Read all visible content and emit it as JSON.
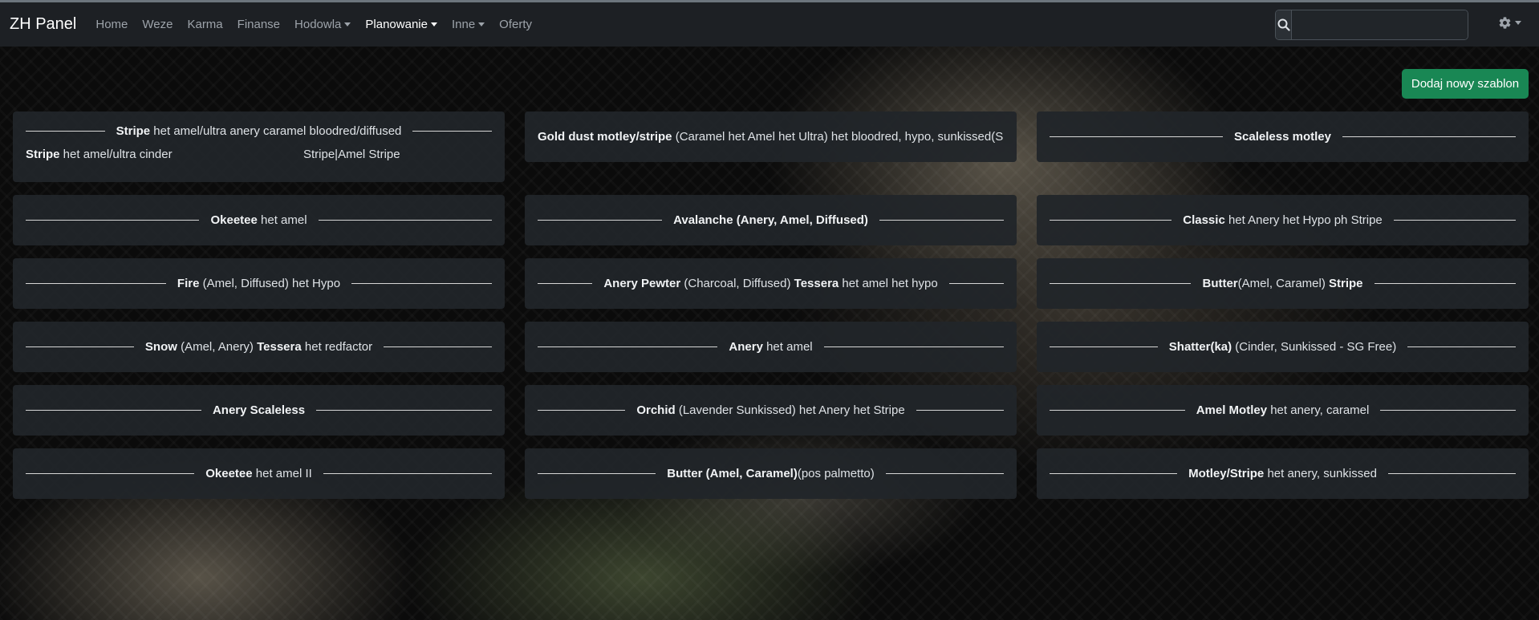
{
  "navbar": {
    "brand": "ZH Panel",
    "items": [
      {
        "label": "Home",
        "dropdown": false,
        "active": false
      },
      {
        "label": "Weze",
        "dropdown": false,
        "active": false
      },
      {
        "label": "Karma",
        "dropdown": false,
        "active": false
      },
      {
        "label": "Finanse",
        "dropdown": false,
        "active": false
      },
      {
        "label": "Hodowla",
        "dropdown": true,
        "active": false
      },
      {
        "label": "Planowanie",
        "dropdown": true,
        "active": true
      },
      {
        "label": "Inne",
        "dropdown": true,
        "active": false
      },
      {
        "label": "Oferty",
        "dropdown": false,
        "active": false
      }
    ],
    "search": {
      "value": "",
      "placeholder": "",
      "icon": "search-icon"
    },
    "settings": {
      "icon": "gear-icon",
      "dropdown": true
    }
  },
  "actions": {
    "add_template_label": "Dodaj nowy szablon",
    "add_template_color": "#198754"
  },
  "cards": [
    {
      "parts": [
        {
          "text": "Stripe",
          "bold": true
        },
        {
          "text": " het amel/ultra anery caramel bloodred/diffused",
          "bold": false
        }
      ],
      "subrow": {
        "left": [
          {
            "text": "Stripe",
            "bold": true
          },
          {
            "text": " het amel/ultra cinder",
            "bold": false
          }
        ],
        "right": "Stripe|Amel Stripe"
      }
    },
    {
      "align": "left",
      "parts": [
        {
          "text": "Gold dust motley/stripe",
          "bold": true
        },
        {
          "text": " (Caramel het Amel het Ultra) het bloodred, hypo, sunkissed(SG fre",
          "bold": false
        }
      ]
    },
    {
      "parts": [
        {
          "text": "Scaleless motley",
          "bold": true
        }
      ]
    },
    {
      "parts": [
        {
          "text": "Okeetee",
          "bold": true
        },
        {
          "text": " het amel",
          "bold": false
        }
      ]
    },
    {
      "parts": [
        {
          "text": "Avalanche (Anery, Amel, Diffused)",
          "bold": true
        }
      ]
    },
    {
      "parts": [
        {
          "text": "Classic",
          "bold": true
        },
        {
          "text": " het Anery het Hypo ph Stripe",
          "bold": false
        }
      ]
    },
    {
      "parts": [
        {
          "text": "Fire",
          "bold": true
        },
        {
          "text": " (Amel, Diffused) het Hypo",
          "bold": false
        }
      ]
    },
    {
      "parts": [
        {
          "text": "Anery Pewter",
          "bold": true
        },
        {
          "text": " (Charcoal, Diffused) ",
          "bold": false
        },
        {
          "text": "Tessera",
          "bold": true
        },
        {
          "text": " het amel het hypo",
          "bold": false
        }
      ]
    },
    {
      "parts": [
        {
          "text": "Butter",
          "bold": true
        },
        {
          "text": "(Amel, Caramel) ",
          "bold": false
        },
        {
          "text": "Stripe",
          "bold": true
        }
      ]
    },
    {
      "parts": [
        {
          "text": "Snow",
          "bold": true
        },
        {
          "text": " (Amel, Anery) ",
          "bold": false
        },
        {
          "text": "Tessera",
          "bold": true
        },
        {
          "text": " het redfactor",
          "bold": false
        }
      ]
    },
    {
      "parts": [
        {
          "text": "Anery",
          "bold": true
        },
        {
          "text": " het amel",
          "bold": false
        }
      ]
    },
    {
      "parts": [
        {
          "text": "Shatter(ka)",
          "bold": true
        },
        {
          "text": " (Cinder, Sunkissed - SG Free)",
          "bold": false
        }
      ]
    },
    {
      "parts": [
        {
          "text": "Anery Scaleless",
          "bold": true
        }
      ]
    },
    {
      "parts": [
        {
          "text": "Orchid",
          "bold": true
        },
        {
          "text": " (Lavender Sunkissed) het Anery het Stripe",
          "bold": false
        }
      ]
    },
    {
      "parts": [
        {
          "text": "Amel Motley",
          "bold": true
        },
        {
          "text": " het anery, caramel",
          "bold": false
        }
      ]
    },
    {
      "parts": [
        {
          "text": "Okeetee",
          "bold": true
        },
        {
          "text": " het amel II",
          "bold": false
        }
      ]
    },
    {
      "parts": [
        {
          "text": "Butter (Amel, Caramel)",
          "bold": true
        },
        {
          "text": "(pos palmetto)",
          "bold": false
        }
      ]
    },
    {
      "parts": [
        {
          "text": "Motley/Stripe",
          "bold": true
        },
        {
          "text": " het anery, sunkissed",
          "bold": false
        }
      ]
    }
  ]
}
